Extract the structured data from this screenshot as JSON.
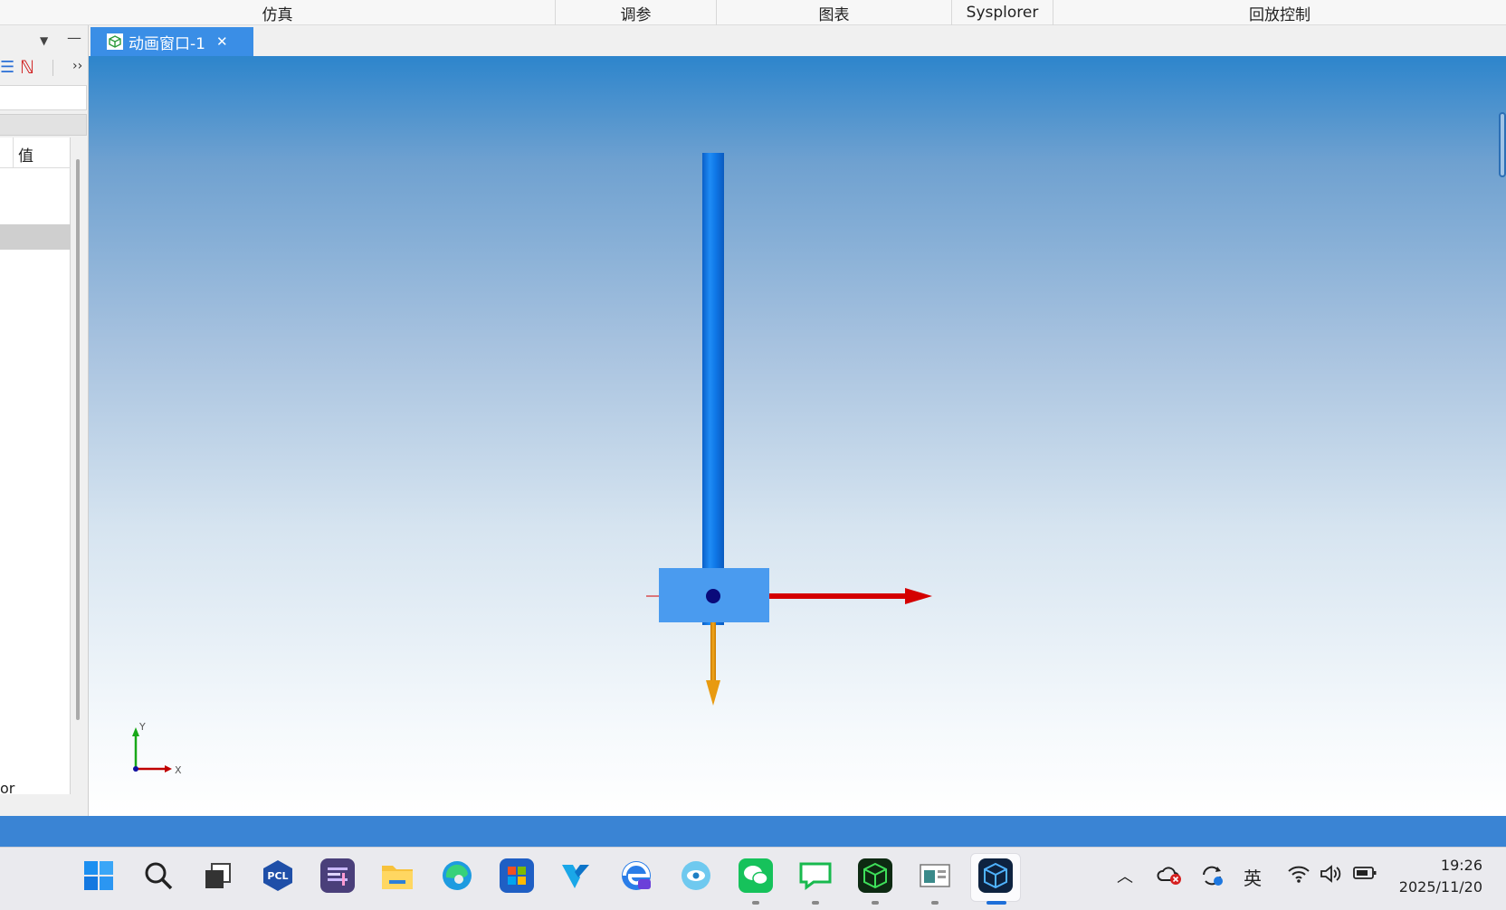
{
  "ribbon": {
    "groups": [
      "仿真",
      "调参",
      "图表",
      "Sysplorer",
      "回放控制"
    ]
  },
  "left_panel": {
    "column_value_header": "值",
    "partial_text": "or",
    "more_glyph": "››"
  },
  "tab": {
    "label": "动画窗口-1",
    "close_glyph": "✕"
  },
  "viewport": {
    "axis_y_label": "Y",
    "axis_x_label": "X"
  },
  "taskbar": {
    "pcl_label": "PCL",
    "ime_label": "英",
    "time": "19:26",
    "date": "2025/11/20"
  },
  "colors": {
    "tab_active": "#3a8ee6",
    "status_bar": "#3a84d4",
    "rod_blue": "#1a7de0",
    "arrow_red": "#d40000",
    "arrow_orange": "#e89a10"
  }
}
